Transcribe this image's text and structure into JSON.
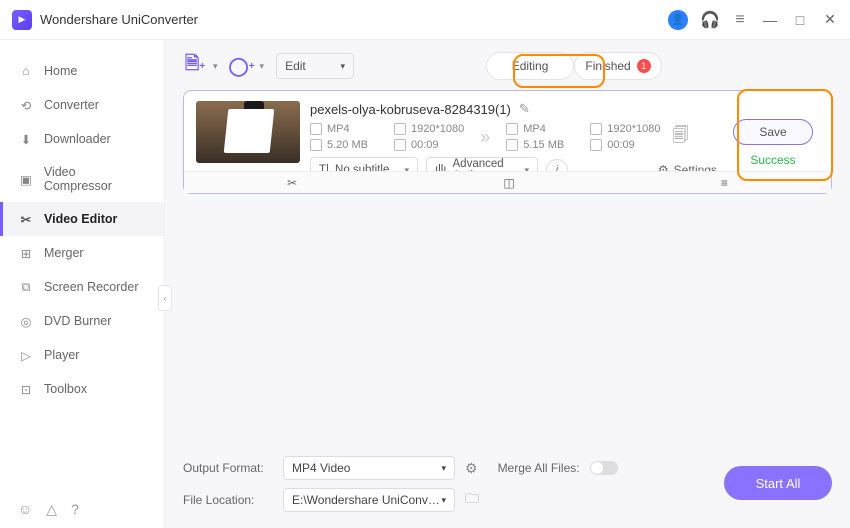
{
  "app": {
    "title": "Wondershare UniConverter"
  },
  "sidebar": {
    "items": [
      {
        "label": "Home",
        "icon": "home"
      },
      {
        "label": "Converter",
        "icon": "converter"
      },
      {
        "label": "Downloader",
        "icon": "downloader"
      },
      {
        "label": "Video Compressor",
        "icon": "compressor"
      },
      {
        "label": "Video Editor",
        "icon": "editor",
        "active": true
      },
      {
        "label": "Merger",
        "icon": "merger"
      },
      {
        "label": "Screen Recorder",
        "icon": "recorder"
      },
      {
        "label": "DVD Burner",
        "icon": "dvd"
      },
      {
        "label": "Player",
        "icon": "player"
      },
      {
        "label": "Toolbox",
        "icon": "toolbox"
      }
    ]
  },
  "toolbar": {
    "edit_label": "Edit",
    "tab_editing": "Editing",
    "tab_finished": "Finished",
    "finished_count": "1"
  },
  "file": {
    "name": "pexels-olya-kobruseva-8284319(1)",
    "source": {
      "format": "MP4",
      "resolution": "1920*1080",
      "size": "5.20 MB",
      "duration": "00:09"
    },
    "target": {
      "format": "MP4",
      "resolution": "1920*1080",
      "size": "5.15 MB",
      "duration": "00:09"
    },
    "subtitle_label": "No subtitle",
    "audio_label": "Advanced Aud...",
    "settings_label": "Settings",
    "save_label": "Save",
    "status": "Success"
  },
  "footer": {
    "output_format_label": "Output Format:",
    "output_format_value": "MP4 Video",
    "merge_label": "Merge All Files:",
    "location_label": "File Location:",
    "location_value": "E:\\Wondershare UniConverter",
    "start_all": "Start All"
  }
}
